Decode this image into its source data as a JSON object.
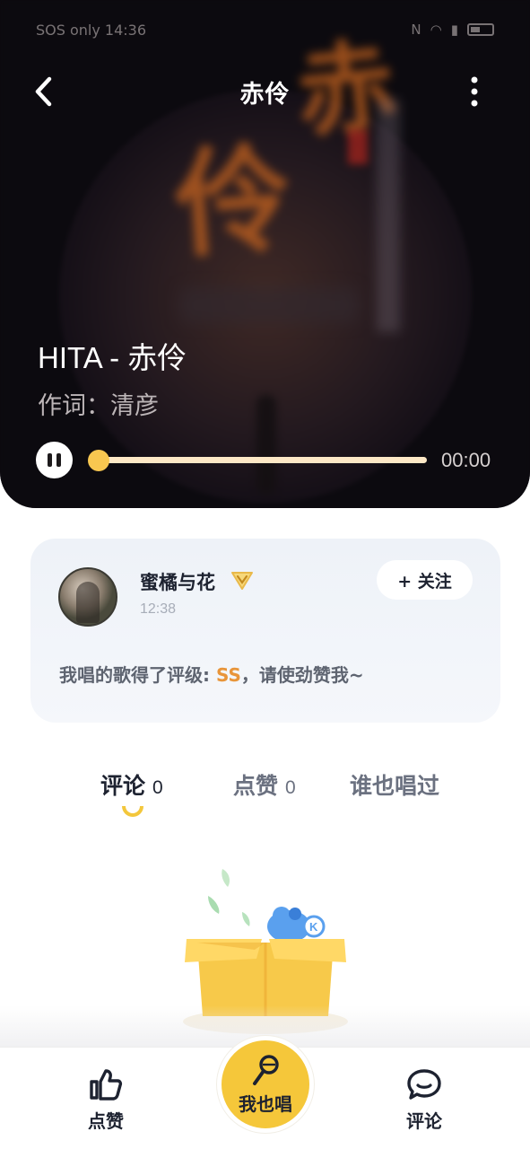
{
  "status_bar": {
    "left_text": "SOS only 14:36",
    "icons": [
      "gear-icon",
      "nfc-icon",
      "wifi-icon",
      "sim-icon",
      "battery-icon"
    ]
  },
  "header": {
    "title": "赤伶",
    "back_icon": "chevron-left-icon",
    "more_icon": "more-vertical-icon"
  },
  "song": {
    "name": "HITA - 赤伶",
    "lyricist": "作词：清彦"
  },
  "player": {
    "state": "playing",
    "current_time": "00:00",
    "progress": 0.0
  },
  "post": {
    "user_name": "蜜橘与花",
    "badge_icon": "vip-badge-icon",
    "time": "12:38",
    "follow_label": "+ 关注",
    "text_prefix": "我唱的歌得了评级: ",
    "grade": "SS",
    "text_suffix": "，请使劲赞我~"
  },
  "tabs": [
    {
      "label": "评论",
      "count": "0",
      "active": true
    },
    {
      "label": "点赞",
      "count": "0",
      "active": false
    },
    {
      "label": "谁也唱过",
      "count": "",
      "active": false
    }
  ],
  "bottom_nav": {
    "like_label": "点赞",
    "sing_label": "我也唱",
    "comment_label": "评论"
  },
  "colors": {
    "accent_yellow": "#f5c73a",
    "grade_orange": "#e8953a",
    "progress_track": "#fde8c6",
    "progress_knob": "#f8c750"
  }
}
